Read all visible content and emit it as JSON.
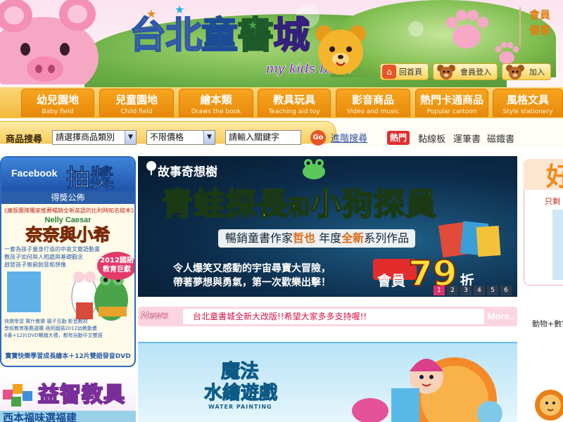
{
  "header": {
    "logo_text": [
      "台",
      "北",
      "童",
      "書",
      "城"
    ],
    "logo_sub": "my kids book",
    "member_lines": [
      "會員",
      "優惠"
    ],
    "top_links": [
      "回首頁",
      "會員登入",
      "加入"
    ]
  },
  "tabs": [
    {
      "zh": "幼兒園地",
      "en": "Baby field"
    },
    {
      "zh": "兒童園地",
      "en": "Child field"
    },
    {
      "zh": "繪本類",
      "en": "Draws the book"
    },
    {
      "zh": "教具玩具",
      "en": "Teaching aid toy"
    },
    {
      "zh": "影音商品",
      "en": "Video and music"
    },
    {
      "zh": "熱門卡通商品",
      "en": "Popular cartoon"
    },
    {
      "zh": "風格文具",
      "en": "Style stationery"
    }
  ],
  "search": {
    "label": "商品搜尋",
    "category_value": "請選擇商品類別",
    "price_value": "不限價格",
    "keyword_value": "請輸入關鍵字",
    "go_label": "Go",
    "advanced_label": "進階搜尋",
    "hot_label": "熱門",
    "hot_words": [
      "黏線板",
      "運筆書",
      "磁鐵書"
    ]
  },
  "facebook_box": {
    "title": "Facebook",
    "draw": "抽獎",
    "subtitle": "得獎公佈",
    "line1": "《康版團隊獨家推薦暢銷全新英語的比利時知名繪本》",
    "nelly": "Nelly Caesar",
    "name": "奈奈與小希",
    "desc": [
      "一套為孩子量身打造的中英文雙語動畫",
      "教孩子如何與人相處與基礎觀念",
      "啟發孩子無窮創意和想像"
    ],
    "badge": "2012國語 教育巨獻",
    "small": [
      "快樂學習 寓什教樂 親子互動 影音教材",
      "學前教育推薦選購 適用國語2012幼教動畫",
      "6書+12片DVD暢銷大禮，都有自動中文雙語"
    ],
    "footer": "寶寶快樂學習成長繪本＋12片雙語發音DVD"
  },
  "edu_box": {
    "title": "益智教具",
    "strip": "西本福味選福建"
  },
  "banner": {
    "brand": "故事奇想樹",
    "title_a": "青蛙探長",
    "title_b": "和",
    "title_c": "小狗探員",
    "author_pre": "暢銷童書作家",
    "author_name": "哲也",
    "author_mid": "年度",
    "author_new": "全新",
    "author_post": "系列作品",
    "desc_lines": [
      "令人爆笑又感動的宇宙尋寶大冒險，",
      "帶著夢想與勇氣，第一次歡樂出擊！"
    ],
    "price_label": "會員",
    "price_value": "79",
    "price_unit": "折",
    "pager": [
      "1",
      "2",
      "3",
      "4",
      "5",
      "6"
    ]
  },
  "news": {
    "label": "News",
    "text": "台北童書城全新大改版!!希望大家多多支持喔!!",
    "more": "More.."
  },
  "magic": {
    "title1": "魔法",
    "title2": "水繪遊戲",
    "en": "WATER PAINTING"
  },
  "right": {
    "big": "好",
    "only": "只剩",
    "animal": "動物+數字"
  },
  "colors": {
    "tab_orange": "#e88a0c",
    "banner_navy": "#0c2c4a",
    "news_pink": "#fbd5e2",
    "link_blue": "#2d4a9e"
  }
}
